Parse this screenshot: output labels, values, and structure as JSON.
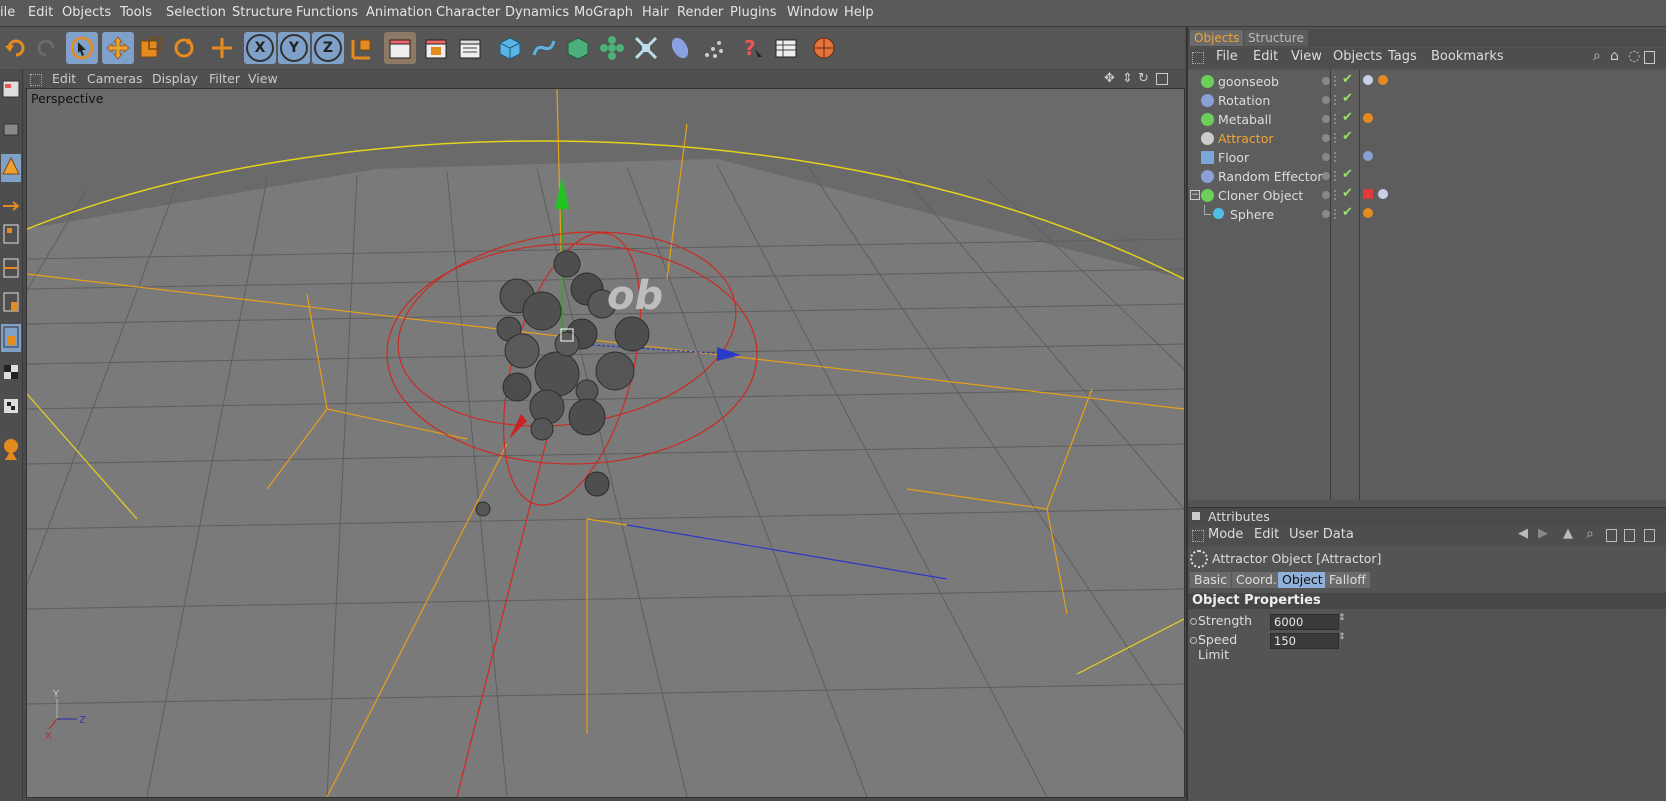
{
  "menubar": {
    "items": [
      "ile",
      "Edit",
      "Objects",
      "Tools",
      "Selection",
      "Structure",
      "Functions",
      "Animation",
      "Character",
      "Dynamics",
      "MoGraph",
      "Hair",
      "Render",
      "Plugins",
      "Window",
      "Help"
    ]
  },
  "toolbar": {
    "axis_x": "X",
    "axis_y": "Y",
    "axis_z": "Z"
  },
  "viewport": {
    "menu": [
      "Edit",
      "Cameras",
      "Display",
      "Filter",
      "View"
    ],
    "label": "Perspective",
    "text_in_scene": "ob",
    "axis_labels": {
      "y": "Y",
      "z": "Z",
      "x": "X"
    }
  },
  "object_manager": {
    "tabs": [
      "Objects",
      "Structure"
    ],
    "menu": [
      "File",
      "Edit",
      "View",
      "Objects",
      "Tags",
      "Bookmarks"
    ],
    "objects": [
      {
        "name": "goonseob",
        "selected": false,
        "icon_color": "#6ccf5a"
      },
      {
        "name": "Rotation",
        "selected": false,
        "icon_color": "#8aa0d6"
      },
      {
        "name": "Metaball",
        "selected": false,
        "icon_color": "#6ccf5a"
      },
      {
        "name": "Attractor",
        "selected": true,
        "icon_color": "#cccccc"
      },
      {
        "name": "Floor",
        "selected": false,
        "icon_color": "#7aa6d8"
      },
      {
        "name": "Random Effector",
        "selected": false,
        "icon_color": "#8aa0d6"
      },
      {
        "name": "Cloner Object",
        "selected": false,
        "icon_color": "#6ccf5a"
      },
      {
        "name": "Sphere",
        "selected": false,
        "icon_color": "#4ec0e8"
      }
    ]
  },
  "attributes": {
    "header": "Attributes",
    "menu": [
      "Mode",
      "Edit",
      "User Data"
    ],
    "object_title": "Attractor Object [Attractor]",
    "tabs": [
      "Basic",
      "Coord.",
      "Object",
      "Falloff"
    ],
    "active_tab": "Object",
    "section": "Object Properties",
    "properties": [
      {
        "label": "Strength . . .",
        "value": "6000"
      },
      {
        "label": "Speed Limit",
        "value": "150"
      }
    ]
  },
  "colors": {
    "selected_text": "#f2a43a",
    "active_tab": "#8fb0d8",
    "viewport_bg": "#808080"
  }
}
